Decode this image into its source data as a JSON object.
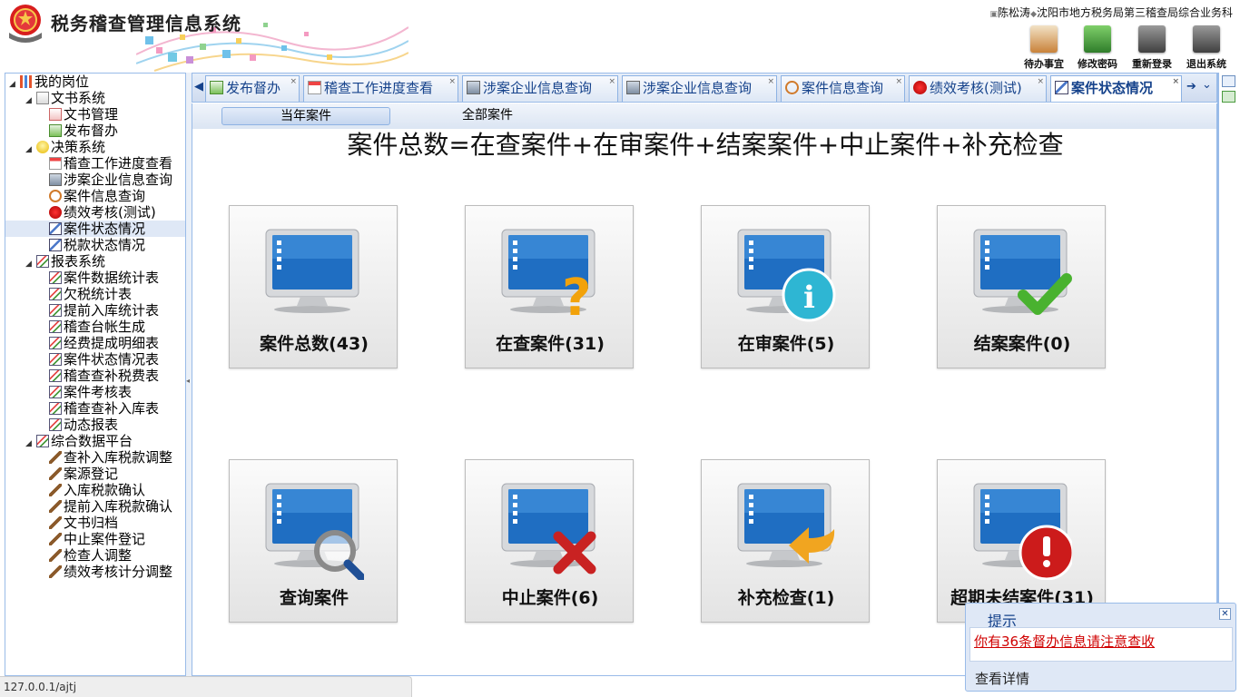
{
  "header": {
    "app_title": "税务稽查管理信息系统",
    "user_name": "陈松涛",
    "org_name": "沈阳市地方税务局第三稽查局综合业务科",
    "buttons": [
      {
        "label": "待办事宜",
        "icon": "clipboard-icon",
        "color": "#c9823a"
      },
      {
        "label": "修改密码",
        "icon": "key-icon",
        "color": "#4a9b3e"
      },
      {
        "label": "重新登录",
        "icon": "relogin-icon",
        "color": "#6b6b6b"
      },
      {
        "label": "退出系统",
        "icon": "power-icon",
        "color": "#6b6b6b"
      }
    ]
  },
  "sidebar": {
    "root": "我的岗位",
    "nodes": [
      {
        "label": "文书系统",
        "level": 1,
        "icon": "document-icon",
        "expanded": true
      },
      {
        "label": "文书管理",
        "level": 2,
        "icon": "doc-edit-icon"
      },
      {
        "label": "发布督办",
        "level": 2,
        "icon": "publish-icon"
      },
      {
        "label": "决策系统",
        "level": 1,
        "icon": "bulb-icon",
        "expanded": true
      },
      {
        "label": "稽查工作进度查看",
        "level": 2,
        "icon": "calendar-icon"
      },
      {
        "label": "涉案企业信息查询",
        "level": 2,
        "icon": "building-icon"
      },
      {
        "label": "案件信息查询",
        "level": 2,
        "icon": "magnifier-icon"
      },
      {
        "label": "绩效考核(测试)",
        "level": 2,
        "icon": "ribbon-icon"
      },
      {
        "label": "案件状态情况",
        "level": 2,
        "icon": "chart-edit-icon",
        "selected": true
      },
      {
        "label": "税款状态情况",
        "level": 2,
        "icon": "chart-edit-icon"
      },
      {
        "label": "报表系统",
        "level": 1,
        "icon": "report-icon",
        "expanded": true
      },
      {
        "label": "案件数据统计表",
        "level": 2,
        "icon": "report-icon"
      },
      {
        "label": "欠税统计表",
        "level": 2,
        "icon": "report-icon"
      },
      {
        "label": "提前入库统计表",
        "level": 2,
        "icon": "report-icon"
      },
      {
        "label": "稽查台帐生成",
        "level": 2,
        "icon": "report-icon"
      },
      {
        "label": "经费提成明细表",
        "level": 2,
        "icon": "report-icon"
      },
      {
        "label": "案件状态情况表",
        "level": 2,
        "icon": "report-icon"
      },
      {
        "label": "稽查查补税费表",
        "level": 2,
        "icon": "report-icon"
      },
      {
        "label": "案件考核表",
        "level": 2,
        "icon": "report-icon"
      },
      {
        "label": "稽查查补入库表",
        "level": 2,
        "icon": "report-icon"
      },
      {
        "label": "动态报表",
        "level": 2,
        "icon": "report-icon"
      },
      {
        "label": "综合数据平台",
        "level": 1,
        "icon": "report-icon",
        "expanded": true
      },
      {
        "label": "查补入库税款调整",
        "level": 2,
        "icon": "wand-icon"
      },
      {
        "label": "案源登记",
        "level": 2,
        "icon": "wand-icon"
      },
      {
        "label": "入库税款确认",
        "level": 2,
        "icon": "wand-icon"
      },
      {
        "label": "提前入库税款确认",
        "level": 2,
        "icon": "wand-icon"
      },
      {
        "label": "文书归档",
        "level": 2,
        "icon": "wand-icon"
      },
      {
        "label": "中止案件登记",
        "level": 2,
        "icon": "wand-icon"
      },
      {
        "label": "检查人调整",
        "level": 2,
        "icon": "wand-icon"
      },
      {
        "label": "绩效考核计分调整",
        "level": 2,
        "icon": "wand-icon"
      }
    ]
  },
  "tabs": [
    {
      "label": "发布督办",
      "icon": "publish-icon"
    },
    {
      "label": "稽查工作进度查看",
      "icon": "calendar-icon"
    },
    {
      "label": "涉案企业信息查询",
      "icon": "building-icon"
    },
    {
      "label": "涉案企业信息查询",
      "icon": "building-icon"
    },
    {
      "label": "案件信息查询",
      "icon": "magnifier-icon"
    },
    {
      "label": "绩效考核(测试)",
      "icon": "ribbon-icon"
    },
    {
      "label": "案件状态情况",
      "icon": "chart-edit-icon",
      "active": true
    }
  ],
  "subtabs": [
    {
      "label": "当年案件",
      "active": true
    },
    {
      "label": "全部案件"
    }
  ],
  "main": {
    "formula": "案件总数=在查案件+在审案件+结案案件+中止案件+补充检查",
    "cards": [
      {
        "label": "案件总数(43)",
        "badge": "none"
      },
      {
        "label": "在查案件(31)",
        "badge": "question"
      },
      {
        "label": "在审案件(5)",
        "badge": "info"
      },
      {
        "label": "结案案件(0)",
        "badge": "check"
      },
      {
        "label": "查询案件",
        "badge": "search"
      },
      {
        "label": "中止案件(6)",
        "badge": "cross"
      },
      {
        "label": "补充检查(1)",
        "badge": "arrow"
      },
      {
        "label": "超期未结案件(31)",
        "badge": "alert"
      }
    ]
  },
  "status_url": "127.0.0.1/ajtj",
  "notify": {
    "title": "提示",
    "message": "你有36条督办信息请注意查收",
    "detail": "查看详情"
  },
  "colors": {
    "accent": "#15428b",
    "border": "#99bbe8",
    "alert_text": "#d00000"
  }
}
